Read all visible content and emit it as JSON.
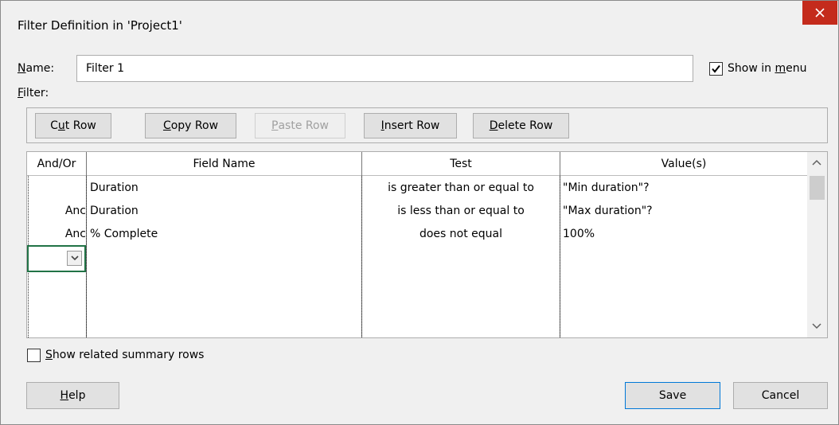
{
  "window": {
    "title": "Filter Definition in 'Project1'"
  },
  "name_field": {
    "label": "Name:",
    "value": "Filter 1"
  },
  "show_in_menu": {
    "label_pre": "Show in ",
    "label_ul": "m",
    "label_post": "enu",
    "checked": true
  },
  "filter_label": "Filter:",
  "toolbar": {
    "cut_row": {
      "pre": "C",
      "ul": "u",
      "post": "t Row"
    },
    "copy_row": {
      "pre": "",
      "ul": "C",
      "post": "opy Row"
    },
    "paste_row": {
      "pre": "",
      "ul": "P",
      "post": "aste Row"
    },
    "insert_row": {
      "pre": "",
      "ul": "I",
      "post": "nsert Row"
    },
    "delete_row": {
      "pre": "",
      "ul": "D",
      "post": "elete Row"
    }
  },
  "grid": {
    "columns": [
      "And/Or",
      "Field Name",
      "Test",
      "Value(s)"
    ],
    "rows": [
      {
        "andor": "",
        "field": "Duration",
        "test": "is greater than or equal to",
        "value": "\"Min duration\"?"
      },
      {
        "andor": "Anc",
        "field": "Duration",
        "test": "is less than or equal to",
        "value": "\"Max duration\"?"
      },
      {
        "andor": "Anc",
        "field": "% Complete",
        "test": "does not equal",
        "value": "100%"
      }
    ]
  },
  "show_related": {
    "label_ul": "S",
    "label_post": "how related summary rows",
    "checked": false
  },
  "buttons": {
    "help": {
      "ul": "H",
      "post": "elp"
    },
    "save": "Save",
    "cancel": "Cancel"
  },
  "colors": {
    "close_bg": "#c42b1c",
    "selection_border": "#217346",
    "default_button_border": "#0078d7"
  },
  "icons": [
    "close-icon",
    "checkmark-icon",
    "dropdown-chevron-icon",
    "scroll-up-icon",
    "scroll-down-icon"
  ]
}
